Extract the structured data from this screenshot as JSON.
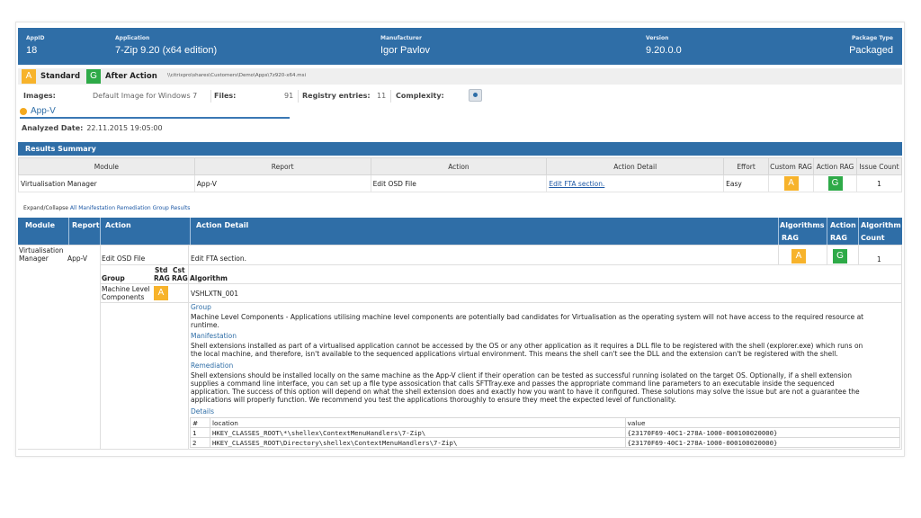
{
  "header": {
    "appid_label": "AppID",
    "appid": "18",
    "application_label": "Application",
    "application": "7-Zip 9.20 (x64 edition)",
    "manufacturer_label": "Manufacturer",
    "manufacturer": "Igor Pavlov",
    "version_label": "Version",
    "version": "9.20.0.0",
    "package_type_label": "Package Type",
    "package_type": "Packaged"
  },
  "mode": {
    "standard_rag": "A",
    "standard_label": "Standard",
    "after_rag": "G",
    "after_label": "After Action",
    "path": "\\\\citrixpro\\shares\\Customers\\Demo\\Apps\\7z920-x64.msi"
  },
  "info": {
    "images_label": "Images:",
    "images_value": "Default Image for Windows 7",
    "files_label": "Files:",
    "files_value": "91",
    "registry_label": "Registry entries:",
    "registry_value": "11",
    "complexity_label": "Complexity:"
  },
  "platform_tab": "App-V",
  "analyzed": {
    "label": "Analyzed Date:",
    "value": "22.11.2015 19:05:00"
  },
  "summary": {
    "title": "Results Summary",
    "headers": [
      "Module",
      "Report",
      "Action",
      "Action Detail",
      "Effort",
      "Custom RAG",
      "Action RAG",
      "Issue Count"
    ],
    "row": {
      "module": "Virtualisation Manager",
      "report": "App-V",
      "action": "Edit OSD File",
      "action_detail": "Edit FTA section.",
      "effort": "Easy",
      "custom_rag": "A",
      "action_rag": "G",
      "issue_count": "1"
    }
  },
  "expand": {
    "label": "Expand/Collapse",
    "link": "All Manifestation Remediation Group Results"
  },
  "main": {
    "headers": {
      "module": "Module",
      "report": "Report",
      "action": "Action",
      "action_detail": "Action Detail",
      "alg_rag_1": "Algorithms",
      "alg_rag_2": "RAG",
      "act_rag_1": "Action",
      "act_rag_2": "RAG",
      "alg_count_1": "Algorithm",
      "alg_count_2": "Count"
    },
    "row": {
      "module_1": "Virtualisation",
      "module_2": "Manager",
      "report": "App-V",
      "action": "Edit OSD File",
      "action_detail": "Edit FTA section.",
      "alg_rag": "A",
      "action_rag": "G",
      "alg_count": "1"
    },
    "sub": {
      "group_label": "Group",
      "std_rag_1": "Std",
      "std_rag_2": "RAG",
      "cst_rag_1": "Cst",
      "cst_rag_2": "RAG",
      "algorithm_label": "Algorithm",
      "group_1": "Machine Level",
      "group_2": "Components",
      "std_rag": "A",
      "algorithm": "VSHLXTN_001"
    },
    "group_section_label": "Group",
    "group_text_1": "Machine Level Components - Applications utilising machine level components are potentially bad candidates for Virtualisation as the operating system will not have access to the required resource at",
    "group_text_2": "runtime.",
    "manifestation_label": "Manifestation",
    "manifestation_text_1": "Shell extensions installed as part of a virtualised application cannot be accessed by the OS or any other application as it requires a DLL file to be registered with the shell (explorer.exe) which runs on",
    "manifestation_text_2": "the local machine, and therefore, isn't available to the sequenced applications virtual environment. This means the shell can't see the DLL and the extension can't be registered with the shell.",
    "remediation_label": "Remediation",
    "remediation_text_1": "Shell extensions should be installed locally on the same machine as the App-V client if their operation can be tested as successful running isolated on the target OS. Optionally, if a shell extension",
    "remediation_text_2": "supplies a command line interface, you can set up a file type assosication that calls SFTTray.exe and passes the appropriate command line parameters to an executable inside the sequenced",
    "remediation_text_3": "application. The success of this option will depend on what the shell extension does and exactly how you want to have it configured. These solutions may solve the issue but are not a guarantee the",
    "remediation_text_4": "applications will properly function. We recommend you test the applications thoroughly to ensure they meet the expected level of functionality.",
    "details_label": "Details",
    "details_headers": [
      "#",
      "location",
      "value"
    ],
    "details_rows": [
      [
        "1",
        "HKEY_CLASSES_ROOT\\*\\shellex\\ContextMenuHandlers\\7-Zip\\",
        "{23170F69-40C1-278A-1000-000100020000}"
      ],
      [
        "2",
        "HKEY_CLASSES_ROOT\\Directory\\shellex\\ContextMenuHandlers\\7-Zip\\",
        "{23170F69-40C1-278A-1000-000100020000}"
      ]
    ]
  },
  "colors": {
    "header_blue": "#2f6ea7",
    "rag_amber": "#f7b32b",
    "rag_green": "#2eaa48",
    "link_blue": "#1f5aa6"
  }
}
